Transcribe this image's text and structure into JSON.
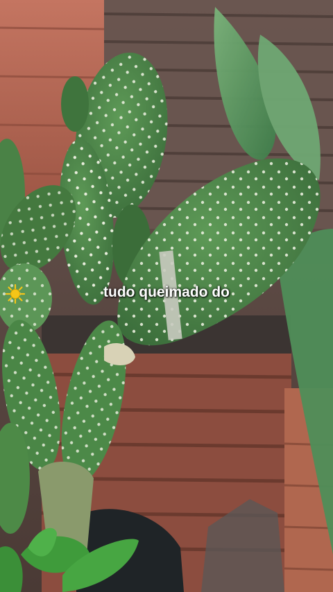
{
  "caption": {
    "text": "tudo queimado do",
    "emoji_icon": "sun-icon"
  },
  "colors": {
    "brick": "#b5644e",
    "brick_dark": "#7a4436",
    "wall_gray": "#5a4a44",
    "cactus": "#4f8a4c",
    "cactus_light": "#7fb072",
    "snake_plant": "#5d9a62",
    "leaf_bright": "#3e9a3a",
    "pot": "#1d2226",
    "sun": "#f5c518"
  }
}
